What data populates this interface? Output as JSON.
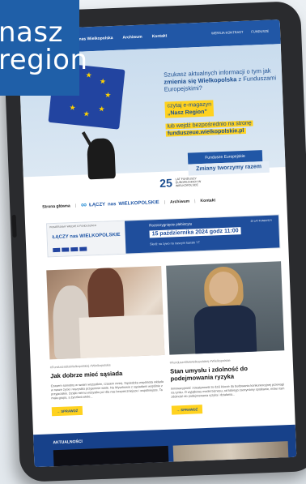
{
  "logo": {
    "line1": "nasz",
    "line2": "region"
  },
  "topbar": {
    "nav": [
      "Łączy nas Wielkopolska",
      "Archiwum",
      "Kontakt"
    ],
    "icons": [
      {
        "name": "accessibility-icon",
        "label": "WERSJA KONTRAST"
      },
      {
        "name": "eu-icon",
        "label": "FUNDUSZE"
      }
    ]
  },
  "hero": {
    "heading_pre": "Szukasz aktualnych informacji o tym jak ",
    "heading_bold": "zmienia się Wielkopolska",
    "heading_post": " z Funduszami Europejskimi?",
    "cta1_line1": "czytaj e-magazyn",
    "cta1_line2": "„Nasz Region”",
    "cta2_pre": "lub wejdź bezpośrednio na stronę",
    "cta2_link": "funduszeue.wielkopolskie.pl",
    "fe_label": "Fundusze Europejskie",
    "slogan": "Zmiany tworzymy razem"
  },
  "ue_logo": {
    "mark": "25",
    "text": "LAT FUNDUSZY EUROPEJSKICH W WIELKOPOLSCE"
  },
  "subnav": {
    "home": "Strona główna",
    "brand_top": "ŁĄCZY",
    "brand_mid": "nas",
    "brand_bottom": "WIELKOPOLSKIE",
    "archive": "Archiwum",
    "contact": "Kontakt"
  },
  "banner": {
    "tag": "POSZERZAMY WIEDZĘ O FUNDUSZACH",
    "brand": "ŁĄCZY nas WIELKOPOLSKIE",
    "t1": "Rozstrzygnięcie plebiscytu",
    "t2": "15 października 2024 godz 11:00",
    "t3": "Śledź na żywo na naszym kanale YT",
    "badge": "25 LAT FUNDUSZY"
  },
  "cards": [
    {
      "category": "#FunduszeDlaWielkopolskiej #Wielkopolskie",
      "title": "Jak dobrze mieć sąsiada",
      "desc": "Czasem samotny w swoim wszystkim, czasem mniej. Sąsiedzka wspólnota wkłada w nasze życie i wszystko przyjemnie wiele. Na Wyszkowie z sąsiadami wspólnie z przyjaciółmi. Dzięki niemu wszystko już dla nas bezpieczniejsze i wspólniejsze. Ta mała grupa, a życzliwa wiele...",
      "more": "→ SPRAWDŹ"
    },
    {
      "category": "#FunduszeDlaWielkopolskiej #Wielkopolskie",
      "title": "Stan umysłu i zdolność do podejmowania ryzyka",
      "desc": "Innowacyjność i kreatywność to dziś klucze do budowania konkurencyjnej przewagi na rynku. O wyjątkowy model biznesu, od którego zaczynamy spotkanie, mówi nam zdolność do podejmowania ryzyka i działania...",
      "more": "→ SPRAWDŹ"
    }
  ],
  "news": {
    "label": "AKTUALNOŚCI"
  }
}
